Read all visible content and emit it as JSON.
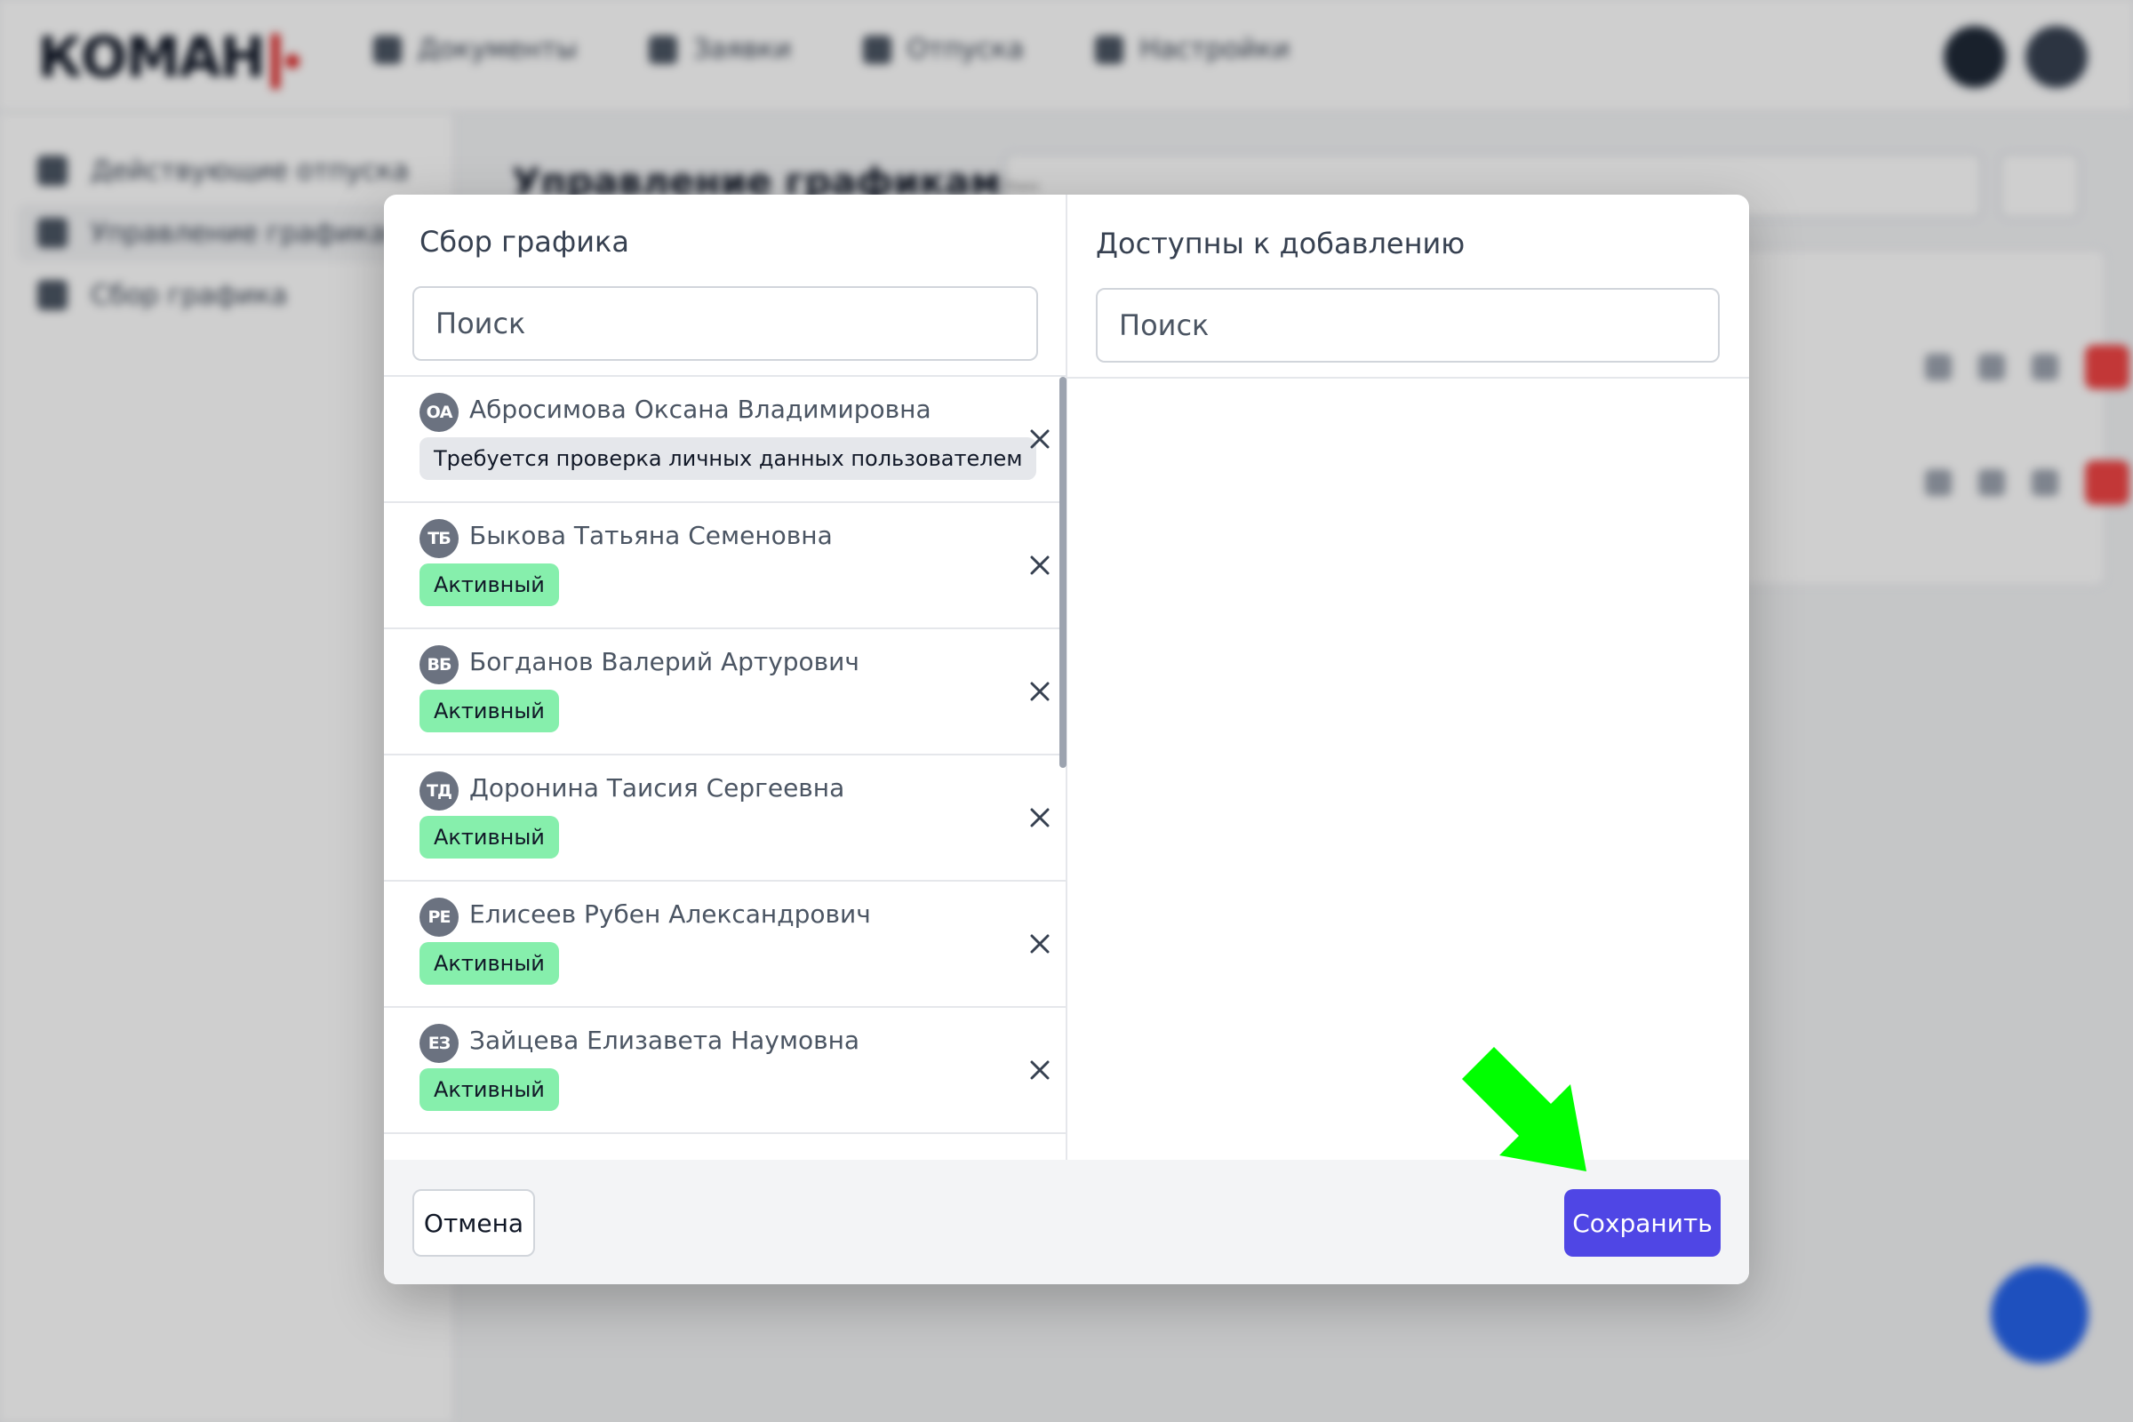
{
  "app": {
    "logo_text": "КОМАН",
    "nav": [
      {
        "label": "Документы",
        "icon": "document-icon"
      },
      {
        "label": "Заявки",
        "icon": "briefcase-icon"
      },
      {
        "label": "Отпуска",
        "icon": "palm-icon"
      },
      {
        "label": "Настройки",
        "icon": "wrench-icon"
      }
    ],
    "sidebar": [
      {
        "label": "Действующие отпуска",
        "icon": "palm-icon"
      },
      {
        "label": "Управление графиками",
        "icon": "list-icon",
        "active": true
      },
      {
        "label": "Сбор графика",
        "icon": "calendar-icon"
      }
    ],
    "main_title": "Управление графиками",
    "main_search_placeholder": "Поиск"
  },
  "modal": {
    "left_title": "Сбор графика",
    "right_title": "Доступны к добавлению",
    "search_placeholder": "Поиск",
    "employees": [
      {
        "initials": "ОА",
        "name": "Абросимова Оксана Владимировна",
        "status": "Требуется проверка личных данных пользователем",
        "status_type": "warn"
      },
      {
        "initials": "ТБ",
        "name": "Быкова Татьяна Семеновна",
        "status": "Активный",
        "status_type": "active"
      },
      {
        "initials": "ВБ",
        "name": "Богданов Валерий Артурович",
        "status": "Активный",
        "status_type": "active"
      },
      {
        "initials": "ТД",
        "name": "Доронина Таисия Сергеевна",
        "status": "Активный",
        "status_type": "active"
      },
      {
        "initials": "РЕ",
        "name": "Елисеев Рубен Александрович",
        "status": "Активный",
        "status_type": "active"
      },
      {
        "initials": "ЕЗ",
        "name": "Зайцева Елизавета Наумовна",
        "status": "Активный",
        "status_type": "active"
      }
    ],
    "available": [],
    "cancel_label": "Отмена",
    "save_label": "Сохранить"
  },
  "colors": {
    "primary": "#4f46e5",
    "active_badge": "#86efac",
    "warn_badge": "#e5e7eb",
    "annotation_arrow": "#00ff00"
  }
}
